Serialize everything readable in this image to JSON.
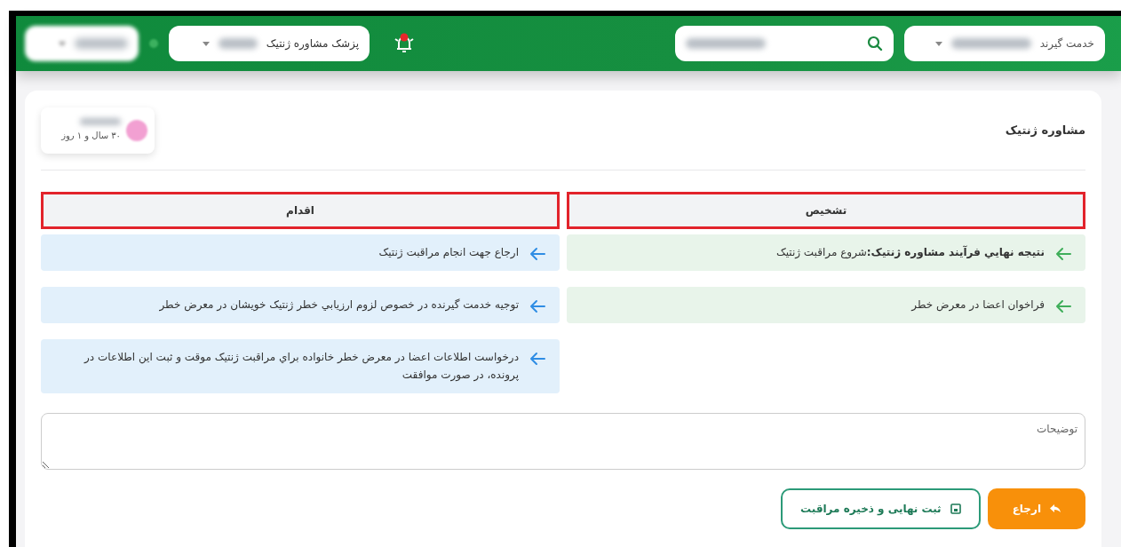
{
  "header": {
    "client_select": {
      "label": "خدمت گیرند"
    },
    "notification": {
      "alert": true
    },
    "doctor_select": {
      "label": "پزشک مشاوره ژنتیک"
    }
  },
  "page_title": "مشاوره ژنتیک",
  "patient": {
    "age": "۳۰ سال و ۱ روز"
  },
  "columns": [
    {
      "heading": "تشخیص",
      "kind": "diagnosis",
      "highlighted": true,
      "items": [
        {
          "text": "**نتیجه نهايي فرآيند مشاوره ژنتيک:**شروع مراقبت ژنتیک"
        },
        {
          "text": "فراخوان اعضا در معرض خطر"
        }
      ]
    },
    {
      "heading": "اقدام",
      "kind": "action",
      "highlighted": true,
      "items": [
        {
          "text": "ارجاع جهت انجام مراقبت ژنتیک"
        },
        {
          "text": "توجیه خدمت گیرنده در خصوص لزوم ارزيابي خطر ژنتیک خویشان در معرض خطر"
        },
        {
          "text": "درخواست اطلاعات اعضا در معرض خطر خانواده براي مراقبت ژنتیک موقت و ثبت این اطلاعات در پرونده، در صورت موافقت"
        }
      ]
    }
  ],
  "notes": {
    "placeholder": "توضیحات"
  },
  "buttons": [
    {
      "label": "ارجاع",
      "kind": "refer"
    },
    {
      "label": "ثبت نهایی و ذخیره مراقبت",
      "kind": "save"
    }
  ]
}
